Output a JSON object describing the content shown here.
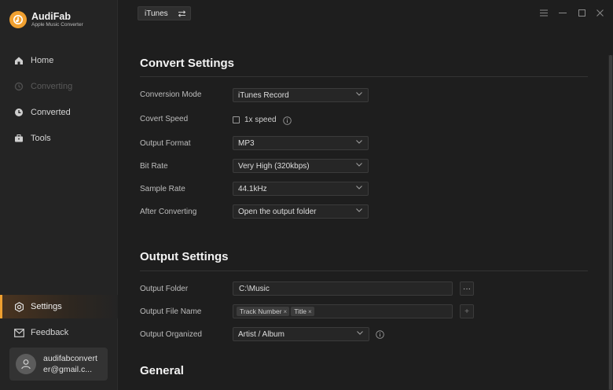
{
  "app": {
    "name": "AudiFab",
    "subtitle": "Apple Music Converter",
    "accent_color": "#f0a030"
  },
  "sidebar": {
    "items": [
      {
        "label": "Home",
        "icon": "home-icon",
        "state": "normal"
      },
      {
        "label": "Converting",
        "icon": "converting-icon",
        "state": "disabled"
      },
      {
        "label": "Converted",
        "icon": "clock-icon",
        "state": "normal"
      },
      {
        "label": "Tools",
        "icon": "toolbox-icon",
        "state": "normal"
      }
    ],
    "bottom_items": [
      {
        "label": "Settings",
        "icon": "gear-icon",
        "state": "active"
      },
      {
        "label": "Feedback",
        "icon": "mail-icon",
        "state": "normal"
      }
    ],
    "account": {
      "email": "audifabconverter@gmail.c..."
    }
  },
  "topbar": {
    "source_label": "iTunes",
    "window_controls": [
      "menu-icon",
      "minimize-icon",
      "maximize-icon",
      "close-icon"
    ]
  },
  "convert_settings": {
    "title": "Convert Settings",
    "conversion_mode": {
      "label": "Conversion Mode",
      "value": "iTunes Record"
    },
    "covert_speed": {
      "label": "Covert Speed",
      "option_label": "1x speed",
      "checked": false
    },
    "output_format": {
      "label": "Output Format",
      "value": "MP3"
    },
    "bit_rate": {
      "label": "Bit Rate",
      "value": "Very High (320kbps)"
    },
    "sample_rate": {
      "label": "Sample Rate",
      "value": "44.1kHz"
    },
    "after_converting": {
      "label": "After Converting",
      "value": "Open the output folder"
    }
  },
  "output_settings": {
    "title": "Output Settings",
    "output_folder": {
      "label": "Output Folder",
      "value": "C:\\Music",
      "browse_label": "···"
    },
    "output_file_name": {
      "label": "Output File Name",
      "tags": [
        "Track Number",
        "Title"
      ],
      "add_label": "+"
    },
    "output_organized": {
      "label": "Output Organized",
      "value": "Artist / Album"
    }
  },
  "general": {
    "title": "General"
  }
}
